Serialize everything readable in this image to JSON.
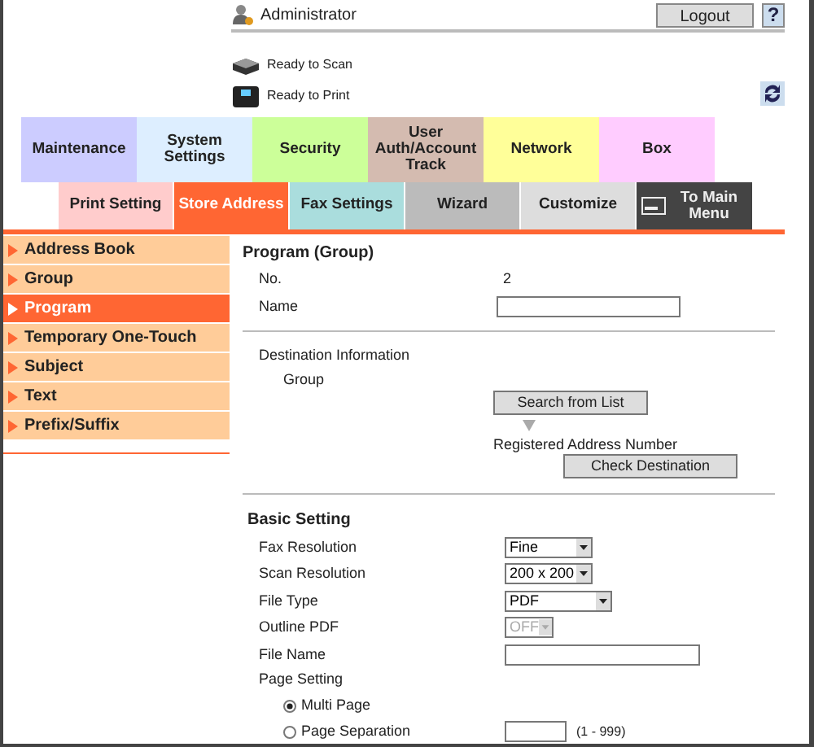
{
  "header": {
    "user": "Administrator",
    "logout": "Logout",
    "help": "?",
    "status": [
      {
        "kind": "scan",
        "text": "Ready to Scan"
      },
      {
        "kind": "print",
        "text": "Ready to Print"
      }
    ]
  },
  "top_tabs": [
    {
      "label": "Maintenance",
      "color": "#ccccff"
    },
    {
      "label": "System Settings",
      "color": "#ddeeff"
    },
    {
      "label": "Security",
      "color": "#ccff99"
    },
    {
      "label": "User Auth/Account Track",
      "color": "#d4bbb0"
    },
    {
      "label": "Network",
      "color": "#ffff99"
    },
    {
      "label": "Box",
      "color": "#ffccff"
    }
  ],
  "sub_tabs": [
    {
      "label": "Print Setting",
      "color": "#ffcccc",
      "selected": false
    },
    {
      "label": "Store Address",
      "color": "#ff6633",
      "selected": true
    },
    {
      "label": "Fax Settings",
      "color": "#aadddd",
      "selected": false
    },
    {
      "label": "Wizard",
      "color": "#bbbbbb",
      "selected": false
    },
    {
      "label": "Customize",
      "color": "#dddddd",
      "selected": false
    }
  ],
  "main_menu": "To Main Menu",
  "sidebar": {
    "items": [
      {
        "label": "Address Book",
        "selected": false
      },
      {
        "label": "Group",
        "selected": false
      },
      {
        "label": "Program",
        "selected": true
      },
      {
        "label": "Temporary One-Touch",
        "selected": false
      },
      {
        "label": "Subject",
        "selected": false
      },
      {
        "label": "Text",
        "selected": false
      },
      {
        "label": "Prefix/Suffix",
        "selected": false
      }
    ]
  },
  "form": {
    "title": "Program (Group)",
    "no_label": "No.",
    "no_value": "2",
    "name_label": "Name",
    "destination": {
      "label": "Destination Information",
      "group": "Group",
      "search_button": "Search from List",
      "registered": "Registered Address Number",
      "check_button": "Check Destination"
    },
    "basic_title": "Basic Setting",
    "rows": [
      {
        "kind": "select",
        "label": "Fax Resolution",
        "value": "Fine",
        "disabled": false
      },
      {
        "kind": "select",
        "label": "Scan Resolution",
        "value": "200 x 200",
        "disabled": false
      },
      {
        "kind": "select",
        "label": "File Type",
        "value": "PDF",
        "disabled": false
      },
      {
        "kind": "select",
        "label": "Outline PDF",
        "value": "OFF",
        "disabled": true
      },
      {
        "kind": "text",
        "label": "File Name"
      },
      {
        "kind": "label",
        "label": "Page Setting"
      },
      {
        "kind": "radio",
        "label": "Multi Page",
        "selected": true
      },
      {
        "kind": "radio",
        "label": "Page Separation",
        "selected": false,
        "range": "(1 - 999)"
      }
    ]
  }
}
